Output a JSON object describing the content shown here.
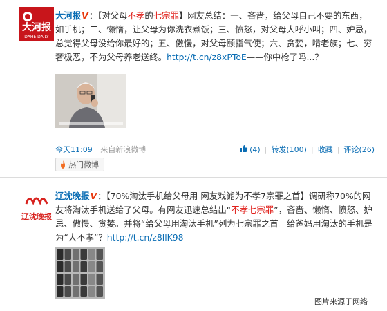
{
  "post1": {
    "author": "大河报",
    "verified_mark": "V",
    "text_a": "：【对父母",
    "text_highlight1": "不孝",
    "text_b": "的",
    "text_highlight2": "七宗罪",
    "text_c": "】网友总结：一、吝啬，给父母自己不要的东西，如手机；二、懒惰，让父母为你洗衣煮饭；三、愤怒，对父母大呼小叫；四、妒忌，总觉得父母没给你最好的；五、傲慢，对父母颐指气使；六、贪婪，啃老族；七、穷奢极恶，不为父母养老送终。",
    "link": "http://t.cn/z8xPToE",
    "text_tail": "——你中枪了吗...？",
    "avatar_text": "大河报",
    "avatar_sub": "DAHE DAILY",
    "time": "今天11:09",
    "source": "来自新浪微博",
    "likes": "(4)",
    "repost": "转发(100)",
    "favorite": "收藏",
    "comment": "评论(26)",
    "hot_tag": "热门微博"
  },
  "post2": {
    "author": "辽沈晚报",
    "verified_mark": "V",
    "text_a": "：【70%淘汰手机给父母用 网友戏谑为不孝7宗罪之首】调研称70%的网友将淘汰手机送给了父母。有网友迅速总结出“",
    "text_highlight": "不孝七宗罪",
    "text_b": "”，吝啬、懒惰、愤怒、妒忌、傲慢、贪婪。并将“给父母用淘汰手机”列为七宗罪之首。给爸妈用淘汰的手机是为“大不孝”？",
    "link": "http://t.cn/z8llK98",
    "avatar_text": "辽沈晚报"
  },
  "watermark": "图片来源于网络",
  "colors": {
    "link": "#0a6db4",
    "highlight": "#e0201b",
    "verified": "#e8390e"
  }
}
